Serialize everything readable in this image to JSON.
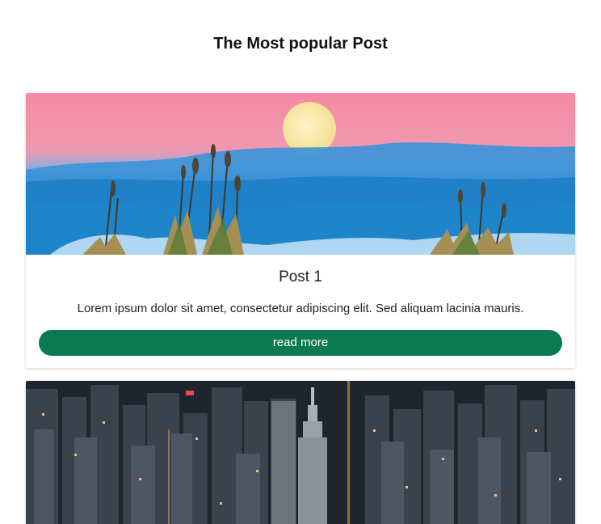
{
  "page": {
    "title": "The Most popular Post"
  },
  "posts": [
    {
      "title": "Post 1",
      "text": "Lorem ipsum dolor sit amet, consectetur adipiscing elit. Sed aliquam lacinia mauris.",
      "button_label": "read more",
      "image": "moon-over-clouds-desert-plants"
    },
    {
      "image": "aerial-city-skyline-night"
    }
  ],
  "colors": {
    "button_bg": "#0b7a50",
    "button_text": "#ffffff",
    "sky_pink": "#f48aa0",
    "sky_blue": "#1e88d0"
  }
}
